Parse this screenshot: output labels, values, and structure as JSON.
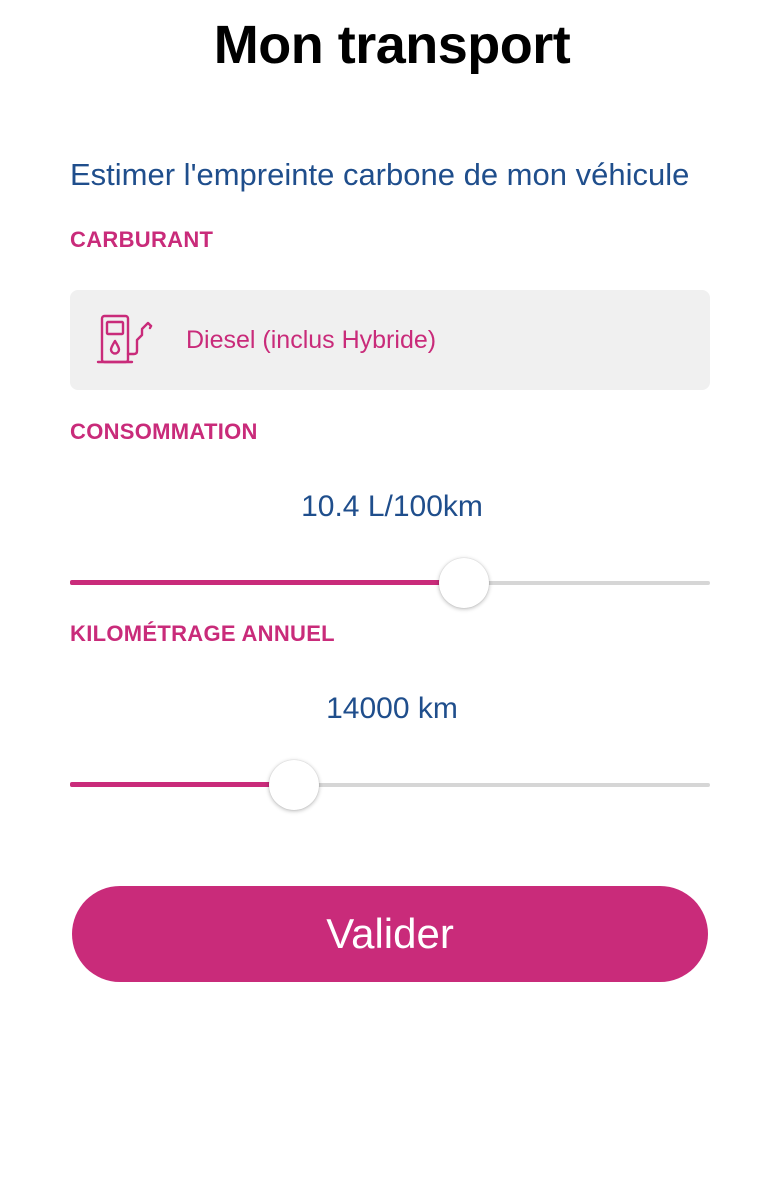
{
  "header": {
    "title": "Mon transport"
  },
  "intro": {
    "subtitle": "Estimer l'empreinte carbone de mon véhicule"
  },
  "fuel": {
    "label": "CARBURANT",
    "icon": "fuel-pump-icon",
    "selected_value": "Diesel (inclus Hybride)"
  },
  "consumption": {
    "label": "CONSOMMATION",
    "value_text": "10.4 L/100km",
    "slider_fill_fraction": 0.615
  },
  "mileage": {
    "label": "KILOMÉTRAGE ANNUEL",
    "value_text": "14000 km",
    "slider_fill_fraction": 0.35
  },
  "actions": {
    "submit_label": "Valider"
  },
  "colors": {
    "accent": "#c92b7a",
    "title_text": "#000000",
    "value_text": "#1f4e8c",
    "field_background": "#f0f0f0",
    "track_inactive": "#d6d6d6"
  }
}
